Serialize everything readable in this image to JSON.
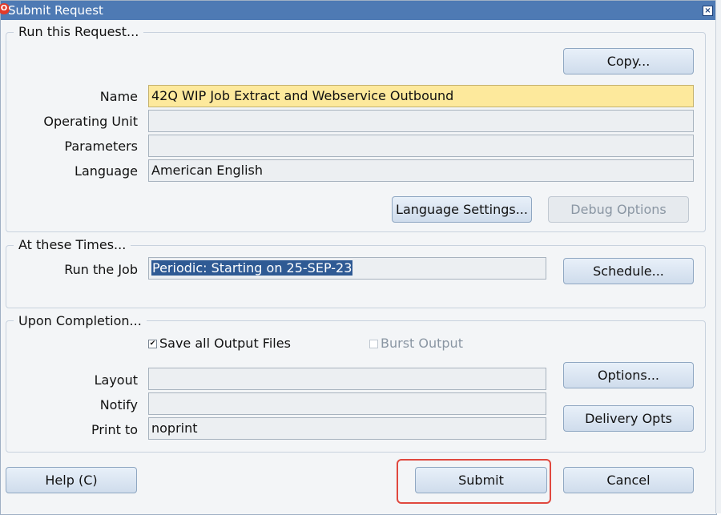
{
  "window": {
    "title": "Submit Request",
    "icon": "oracle-o-icon",
    "close_glyph": "×"
  },
  "run_request": {
    "section_title": "Run this Request...",
    "copy_button": "Copy...",
    "fields": {
      "name_label": "Name",
      "name_value": "42Q WIP Job Extract and Webservice Outbound",
      "operating_unit_label": "Operating Unit",
      "operating_unit_value": "",
      "parameters_label": "Parameters",
      "parameters_value": "",
      "language_label": "Language",
      "language_value": "American English"
    },
    "language_settings_button": "Language Settings...",
    "debug_options_button": "Debug Options"
  },
  "times": {
    "section_title": "At these Times...",
    "run_job_label": "Run the Job",
    "run_job_value": "Periodic: Starting on 25-SEP-23",
    "schedule_button": "Schedule..."
  },
  "completion": {
    "section_title": "Upon Completion...",
    "save_output_label": "Save all Output Files",
    "save_output_checked": true,
    "burst_output_label": "Burst Output",
    "burst_output_checked": false,
    "layout_label": "Layout",
    "layout_value": "",
    "notify_label": "Notify",
    "notify_value": "",
    "print_to_label": "Print to",
    "print_to_value": "noprint",
    "options_button": "Options...",
    "delivery_opts_button": "Delivery Opts"
  },
  "footer": {
    "help_button": "Help (C)",
    "submit_button": "Submit",
    "cancel_button": "Cancel"
  },
  "colors": {
    "titlebar": "#4e7ab4",
    "required_field": "#fde99c",
    "highlight_outline": "#e0483e"
  }
}
